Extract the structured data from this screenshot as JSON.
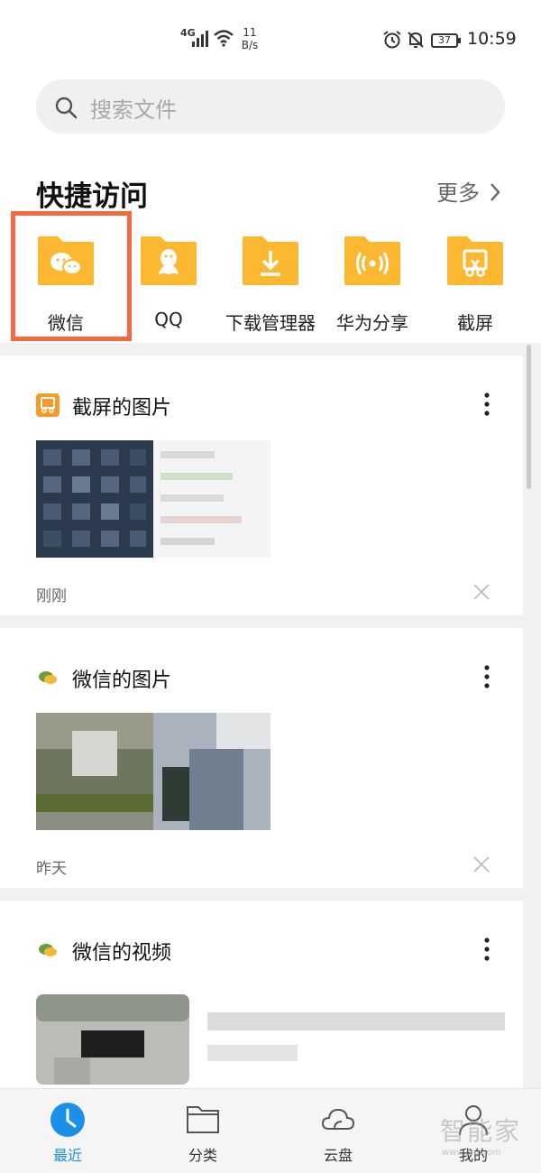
{
  "status_bar": {
    "network": "4G",
    "speed_value": "11",
    "speed_unit": "B/s",
    "battery": "37",
    "time": "10:59"
  },
  "search": {
    "placeholder": "搜索文件"
  },
  "quick_access": {
    "title": "快捷访问",
    "more_label": "更多",
    "items": [
      {
        "label": "微信",
        "icon": "wechat-icon"
      },
      {
        "label": "QQ",
        "icon": "qq-icon"
      },
      {
        "label": "下载管理器",
        "icon": "download-icon"
      },
      {
        "label": "华为分享",
        "icon": "share-icon"
      },
      {
        "label": "截屏",
        "icon": "screenshot-icon"
      }
    ],
    "highlighted_item": "微信"
  },
  "recent": [
    {
      "title": "截屏的图片",
      "time": "刚刚",
      "icon": "screenshot-folder-icon"
    },
    {
      "title": "微信的图片",
      "time": "昨天",
      "icon": "wechat-small-icon"
    },
    {
      "title": "微信的视频",
      "icon": "wechat-small-icon"
    }
  ],
  "bottom_nav": [
    {
      "label": "最近",
      "icon": "clock-icon",
      "active": true
    },
    {
      "label": "分类",
      "icon": "folder-icon",
      "active": false
    },
    {
      "label": "云盘",
      "icon": "cloud-icon",
      "active": false
    },
    {
      "label": "我的",
      "icon": "person-icon",
      "active": false
    }
  ],
  "watermark": {
    "text": "智能家",
    "sub": "www.znj.com"
  },
  "colors": {
    "folder": "#fcb831",
    "highlight": "#f26a3e",
    "active_nav": "#1a90e8"
  }
}
